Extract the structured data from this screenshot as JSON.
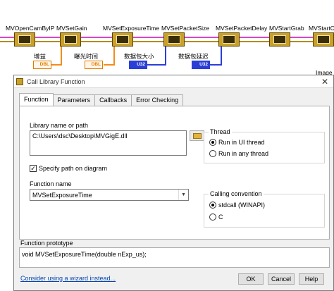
{
  "diagram": {
    "vi_labels": [
      "MVOpenCamByIP",
      "MVSetGain",
      "MVSetExposureTime",
      "MVSetPacketSize",
      "MVSetPacketDelay",
      "MVStartGrab",
      "MVStartC"
    ],
    "constants": [
      {
        "label": "增益",
        "type": "DBL"
      },
      {
        "label": "曝光时间",
        "type": "DBL"
      },
      {
        "label": "数据包大小",
        "type": "U32"
      },
      {
        "label": "数据包延迟",
        "type": "U32"
      }
    ],
    "image_label": "Image"
  },
  "dialog": {
    "title": "Call Library Function",
    "tabs": [
      "Function",
      "Parameters",
      "Callbacks",
      "Error Checking"
    ],
    "library_label": "Library name or path",
    "library_path": "C:\\Users\\dsc\\Desktop\\MVGigE.dll",
    "specify_path_label": "Specify path on diagram",
    "specify_path_checked": "✓",
    "thread_group": "Thread",
    "thread_options": [
      "Run in UI thread",
      "Run in any thread"
    ],
    "function_name_label": "Function name",
    "function_name": "MVSetExposureTime",
    "calling_convention_group": "Calling convention",
    "calling_options": [
      "stdcall (WINAPI)",
      "C"
    ],
    "prototype_label": "Function prototype",
    "prototype": "void  MVSetExposureTime(double nExp_us);",
    "wizard_link": "Consider using a wizard instead...",
    "ok_label": "OK",
    "cancel_label": "Cancel",
    "help_label": "Help"
  }
}
